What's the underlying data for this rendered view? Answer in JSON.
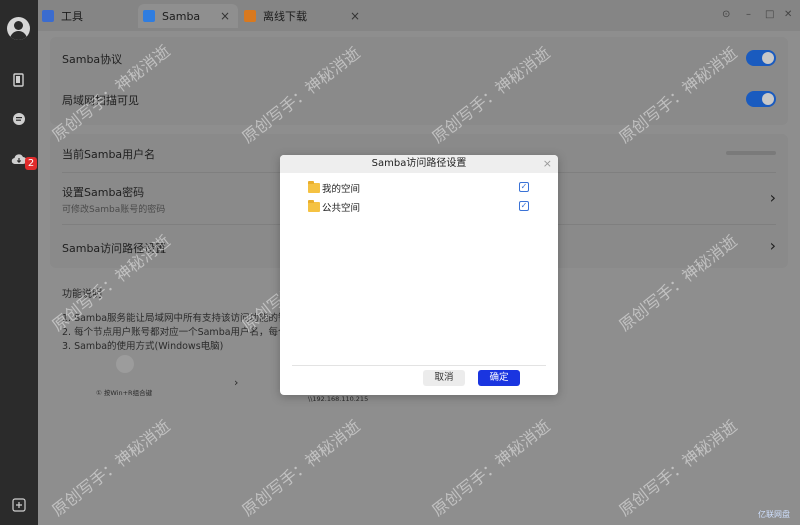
{
  "tabs": [
    {
      "label": "工具",
      "icon": "tools-icon"
    },
    {
      "label": "Samba",
      "icon": "samba-icon",
      "active": true
    },
    {
      "label": "离线下载",
      "icon": "download-icon"
    }
  ],
  "sidebar": {
    "badge_count": "2",
    "icons": [
      "avatar",
      "device-icon",
      "message-icon",
      "cloud-download-icon",
      "add-icon"
    ]
  },
  "settings": {
    "samba_protocol": "Samba协议",
    "lan_visible": "局域网扫描可见",
    "current_user": "当前Samba用户名",
    "set_password": "设置Samba密码",
    "set_password_sub": "可修改Samba账号的密码",
    "access_path": "Samba访问路径设置"
  },
  "function_desc": {
    "title": "功能说明",
    "lines": [
      "1.  Samba服务能让局域网中所有支持该访问功能的智能",
      "2.  每个节点用户账号都对应一个Samba用户名，每个用",
      "3.  Samba的使用方式(Windows电脑)"
    ],
    "step_hint": "① 按Win+R组合键",
    "ip_text": "\\\\192.168.110.215"
  },
  "modal": {
    "title": "Samba访问路径设置",
    "items": [
      {
        "label": "我的空间",
        "checked": true
      },
      {
        "label": "公共空间",
        "checked": true
      }
    ],
    "cancel": "取消",
    "ok": "确定"
  },
  "watermark": "原创写手：神秘消逝",
  "brand": "亿联网盘",
  "colors": {
    "accent": "#1a35e0",
    "toggle": "#1a5bbf",
    "badge": "#e02b2b"
  }
}
